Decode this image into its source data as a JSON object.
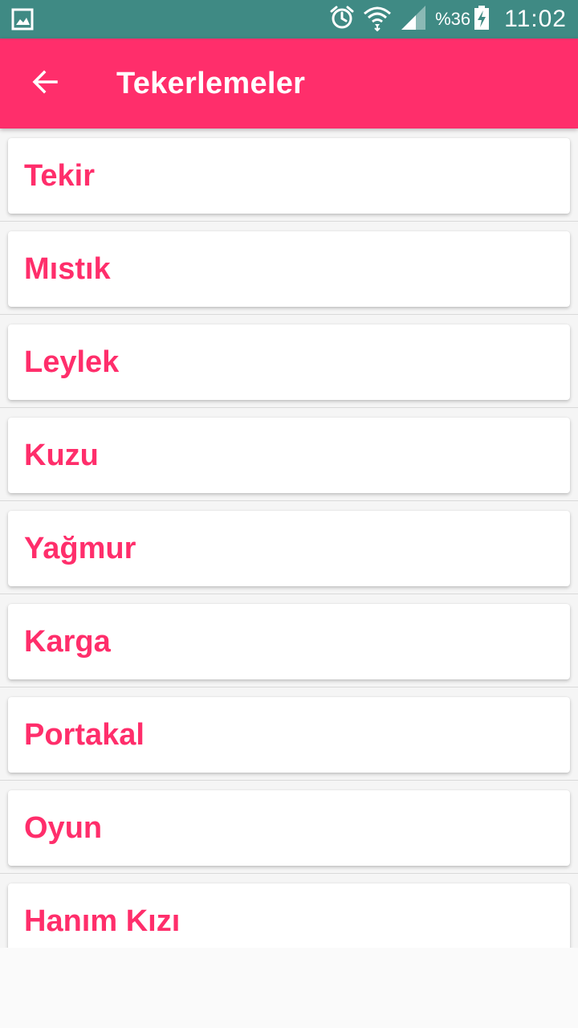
{
  "status_bar": {
    "icons": [
      "gallery-icon",
      "alarm-icon",
      "wifi-icon",
      "signal-icon",
      "battery-charging-icon"
    ],
    "battery_percent": "%36",
    "time": "11:02"
  },
  "app_bar": {
    "back_icon": "arrow-back-icon",
    "title": "Tekerlemeler"
  },
  "list": {
    "items": [
      {
        "label": "Tekir"
      },
      {
        "label": "Mıstık"
      },
      {
        "label": "Leylek"
      },
      {
        "label": "Kuzu"
      },
      {
        "label": "Yağmur"
      },
      {
        "label": "Karga"
      },
      {
        "label": "Portakal"
      },
      {
        "label": "Oyun"
      },
      {
        "label": "Hanım Kızı"
      }
    ]
  },
  "colors": {
    "status_bar": "#3f8a84",
    "accent": "#ff2e6b",
    "card_background": "#ffffff",
    "list_background": "#f5f5f5"
  }
}
